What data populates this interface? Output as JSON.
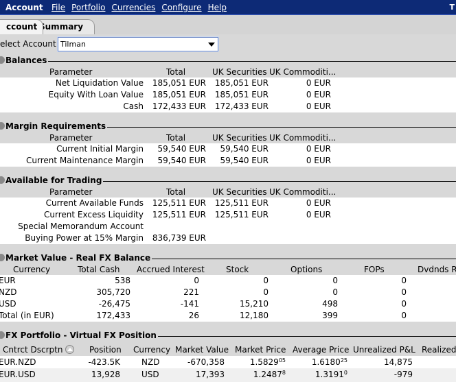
{
  "menubar": {
    "app_title": "Account",
    "menus": [
      "File",
      "Portfolio",
      "Currencies",
      "Configure",
      "Help"
    ],
    "right_title": "T"
  },
  "tabs": [
    "ccount",
    "Summary"
  ],
  "select_account": {
    "label": "elect Account",
    "value": "Tilman"
  },
  "balances": {
    "title": "Balances",
    "headers": [
      "Parameter",
      "Total",
      "UK Securities",
      "UK Commoditi..."
    ],
    "rows": [
      [
        "Net Liquidation Value",
        "185,051 EUR",
        "185,051 EUR",
        "0 EUR"
      ],
      [
        "Equity With Loan Value",
        "185,051 EUR",
        "185,051 EUR",
        "0 EUR"
      ],
      [
        "Cash",
        "172,433 EUR",
        "172,433 EUR",
        "0 EUR"
      ]
    ]
  },
  "margin": {
    "title": "Margin Requirements",
    "headers": [
      "Parameter",
      "Total",
      "UK Securities",
      "UK Commoditi..."
    ],
    "rows": [
      [
        "Current Initial Margin",
        "59,540 EUR",
        "59,540 EUR",
        "0 EUR"
      ],
      [
        "Current Maintenance Margin",
        "59,540 EUR",
        "59,540 EUR",
        "0 EUR"
      ]
    ]
  },
  "trading": {
    "title": "Available for Trading",
    "headers": [
      "Parameter",
      "Total",
      "UK Securities",
      "UK Commoditi..."
    ],
    "rows": [
      [
        "Current Available Funds",
        "125,511 EUR",
        "125,511 EUR",
        "0 EUR"
      ],
      [
        "Current Excess Liquidity",
        "125,511 EUR",
        "125,511 EUR",
        "0 EUR"
      ],
      [
        "Special Memorandum Account",
        "",
        "",
        ""
      ],
      [
        "Buying Power at 15% Margin",
        "836,739 EUR",
        "",
        ""
      ]
    ]
  },
  "market_value": {
    "title": "Market Value - Real FX Balance",
    "headers": [
      "Currency",
      "Total Cash",
      "Accrued Interest",
      "Stock",
      "Options",
      "FOPs",
      "Dvdnds Re"
    ],
    "rows": [
      [
        "EUR",
        "538",
        "0",
        "0",
        "0",
        "0"
      ],
      [
        "NZD",
        "305,720",
        "221",
        "0",
        "0",
        "0"
      ],
      [
        "USD",
        "-26,475",
        "-141",
        "15,210",
        "498",
        "0"
      ],
      [
        "Total (in EUR)",
        "172,433",
        "26",
        "12,180",
        "399",
        "0"
      ]
    ]
  },
  "fx_portfolio": {
    "title": "FX Portfolio - Virtual FX Position",
    "headers": [
      "Cntrct Dscrptn",
      "Position",
      "Currency",
      "Market Value",
      "Market Price",
      "Average Price",
      "Unrealized P&L",
      "Realized"
    ],
    "rows": [
      {
        "desc": "EUR.NZD",
        "position": "-423.5K",
        "currency": "NZD",
        "market_value": "-670,358",
        "mp_main": "1.5829",
        "mp_sup": "05",
        "ap_main": "1.6180",
        "ap_sup": "25",
        "upnl": "14,875"
      },
      {
        "desc": "EUR.USD",
        "position": "13,928",
        "currency": "USD",
        "market_value": "17,393",
        "mp_main": "1.2487",
        "mp_sup": "8",
        "ap_main": "1.3191",
        "ap_sup": "0",
        "upnl": "-979"
      }
    ]
  }
}
